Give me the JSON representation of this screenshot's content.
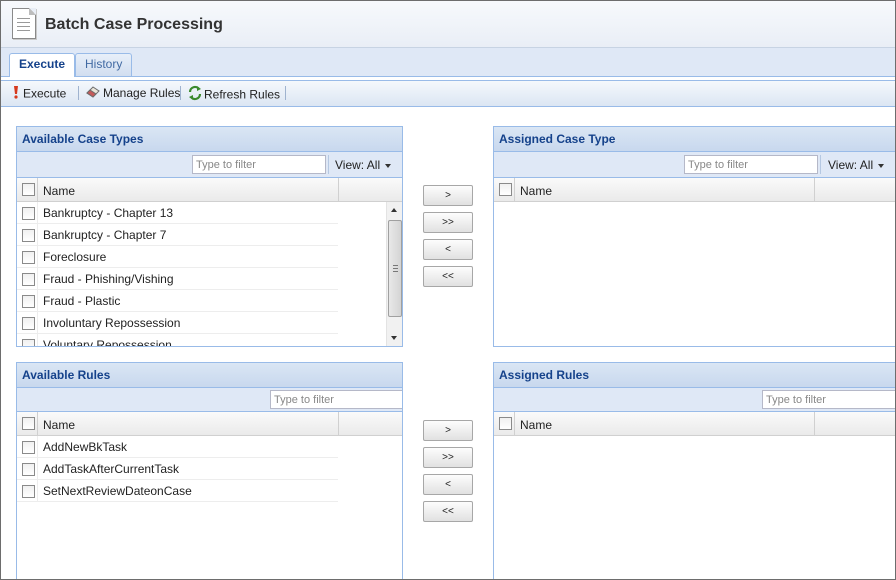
{
  "page": {
    "title": "Batch Case Processing"
  },
  "tabs": [
    {
      "label": "Execute",
      "active": true
    },
    {
      "label": "History",
      "active": false
    }
  ],
  "toolbar": {
    "execute_label": "Execute",
    "manage_rules_label": "Manage Rules",
    "refresh_rules_label": "Refresh Rules"
  },
  "available_case_types": {
    "title": "Available Case Types",
    "filter_placeholder": "Type to filter",
    "view_label": "View: All",
    "column_name": "Name",
    "rows": [
      "Bankruptcy - Chapter 13",
      "Bankruptcy - Chapter 7",
      "Foreclosure",
      "Fraud - Phishing/Vishing",
      "Fraud - Plastic",
      "Involuntary Repossession",
      "Voluntary Repossession"
    ]
  },
  "assigned_case_type": {
    "title": "Assigned Case Type",
    "filter_placeholder": "Type to filter",
    "view_label": "View: All",
    "column_name": "Name",
    "rows": []
  },
  "available_rules": {
    "title": "Available Rules",
    "filter_placeholder": "Type to filter",
    "column_name": "Name",
    "rows": [
      "AddNewBkTask",
      "AddTaskAfterCurrentTask",
      "SetNextReviewDateonCase"
    ]
  },
  "assigned_rules": {
    "title": "Assigned Rules",
    "filter_placeholder": "Type to filter",
    "column_name": "Name",
    "rows": []
  },
  "transfer_buttons": {
    "move_selected": ">",
    "move_all": ">>",
    "remove_selected": "<",
    "remove_all": "<<"
  },
  "colors": {
    "header_text": "#15428b",
    "panel_border": "#99bbe8",
    "toolbar_bg": "#dfe8f6"
  }
}
